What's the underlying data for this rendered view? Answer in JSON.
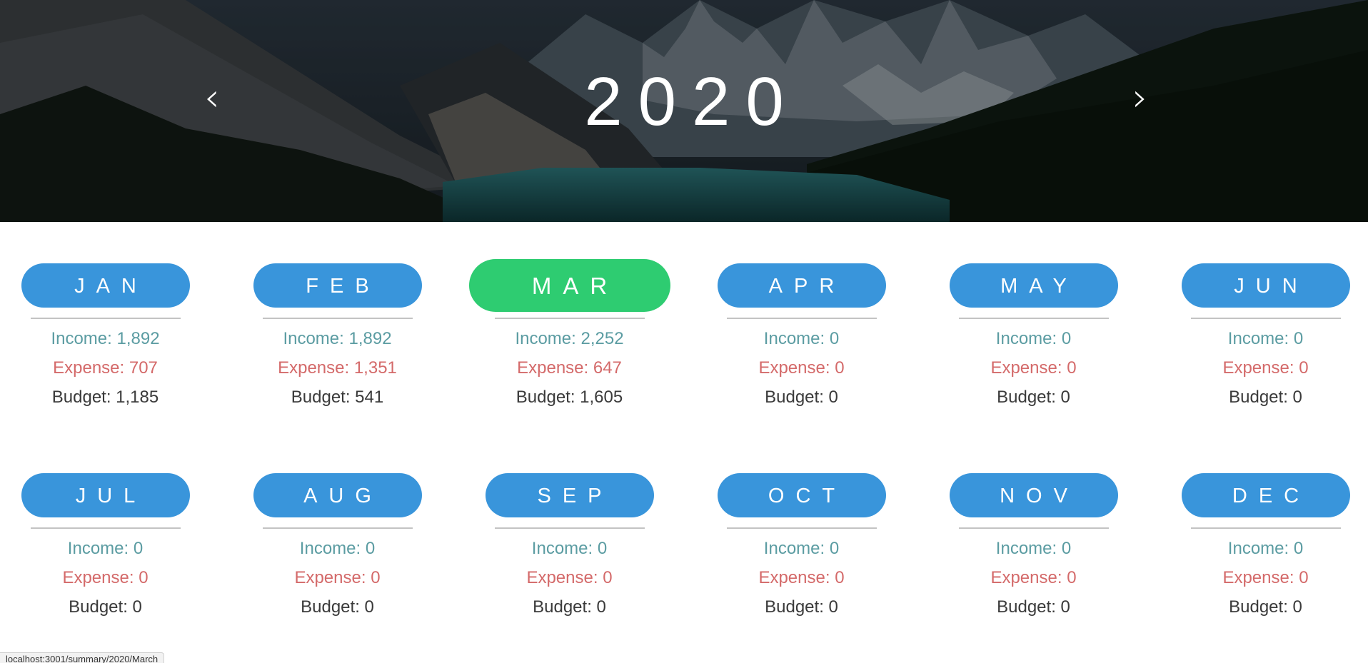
{
  "header": {
    "year": "2020",
    "prev_label": "‹",
    "next_label": "›"
  },
  "colors": {
    "pill": "#3995db",
    "pill_active": "#2ecc71",
    "income": "#5b9ca2",
    "expense": "#d46a6a",
    "budget": "#3a3a3a"
  },
  "active_month": "MAR",
  "months": [
    {
      "label": "JAN",
      "income": "Income: 1,892",
      "expense": "Expense: 707",
      "budget": "Budget: 1,185"
    },
    {
      "label": "FEB",
      "income": "Income: 1,892",
      "expense": "Expense: 1,351",
      "budget": "Budget: 541"
    },
    {
      "label": "MAR",
      "income": "Income: 2,252",
      "expense": "Expense: 647",
      "budget": "Budget: 1,605"
    },
    {
      "label": "APR",
      "income": "Income: 0",
      "expense": "Expense: 0",
      "budget": "Budget: 0"
    },
    {
      "label": "MAY",
      "income": "Income: 0",
      "expense": "Expense: 0",
      "budget": "Budget: 0"
    },
    {
      "label": "JUN",
      "income": "Income: 0",
      "expense": "Expense: 0",
      "budget": "Budget: 0"
    },
    {
      "label": "JUL",
      "income": "Income: 0",
      "expense": "Expense: 0",
      "budget": "Budget: 0"
    },
    {
      "label": "AUG",
      "income": "Income: 0",
      "expense": "Expense: 0",
      "budget": "Budget: 0"
    },
    {
      "label": "SEP",
      "income": "Income: 0",
      "expense": "Expense: 0",
      "budget": "Budget: 0"
    },
    {
      "label": "OCT",
      "income": "Income: 0",
      "expense": "Expense: 0",
      "budget": "Budget: 0"
    },
    {
      "label": "NOV",
      "income": "Income: 0",
      "expense": "Expense: 0",
      "budget": "Budget: 0"
    },
    {
      "label": "DEC",
      "income": "Income: 0",
      "expense": "Expense: 0",
      "budget": "Budget: 0"
    }
  ],
  "status_bar": {
    "url": "localhost:3001/summary/2020/March"
  }
}
